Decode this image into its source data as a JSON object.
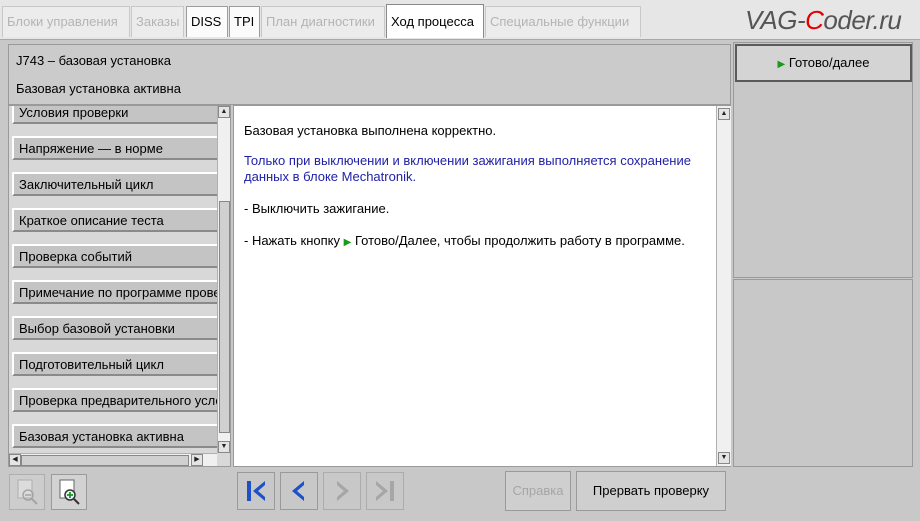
{
  "tabs": [
    {
      "label": "Блоки управления",
      "state": "disabled"
    },
    {
      "label": "Заказы",
      "state": "disabled"
    },
    {
      "label": "DISS",
      "state": "enabled"
    },
    {
      "label": "TPI",
      "state": "enabled"
    },
    {
      "label": "План диагностики",
      "state": "disabled"
    },
    {
      "label": "Ход процесса",
      "state": "active"
    },
    {
      "label": "Специальные функции",
      "state": "disabled"
    }
  ],
  "watermark": {
    "prefix": "VAG-",
    "accent": "C",
    "suffix": "oder.ru"
  },
  "header": {
    "line1": "J743 – базовая установка",
    "line2": "Базовая установка активна"
  },
  "steps": [
    "Условия проверки",
    "Напряжение — в норме",
    "Заключительный цикл",
    "Краткое описание теста",
    "Проверка событий",
    "Примечание по программе проверки",
    "Выбор базовой установки",
    "Подготовительный цикл",
    "Проверка предварительного условия",
    "Базовая установка активна"
  ],
  "content": {
    "p1": "Базовая установка выполнена корректно.",
    "p2": "Только при выключении и включении зажигания выполняется сохранение данных в блоке Mechatronik.",
    "p3": "- Выключить зажигание.",
    "p4_before": "- Нажать кнопку",
    "p4_after": "Готово/Далее, чтобы продолжить работу в программе."
  },
  "buttons": {
    "next": "Готово/далее",
    "help": "Справка",
    "abort": "Прервать проверку"
  },
  "icons": {
    "zoom_out": "zoom-out-icon",
    "zoom_in": "zoom-in-icon",
    "first": "skip-to-first-icon",
    "prev": "previous-icon",
    "next": "next-icon",
    "last": "skip-to-last-icon"
  },
  "colors": {
    "accent_blue": "#1e50c8",
    "play_green": "#1a9a1a",
    "link_text": "#2020a8",
    "watermark_red": "#e30000"
  }
}
